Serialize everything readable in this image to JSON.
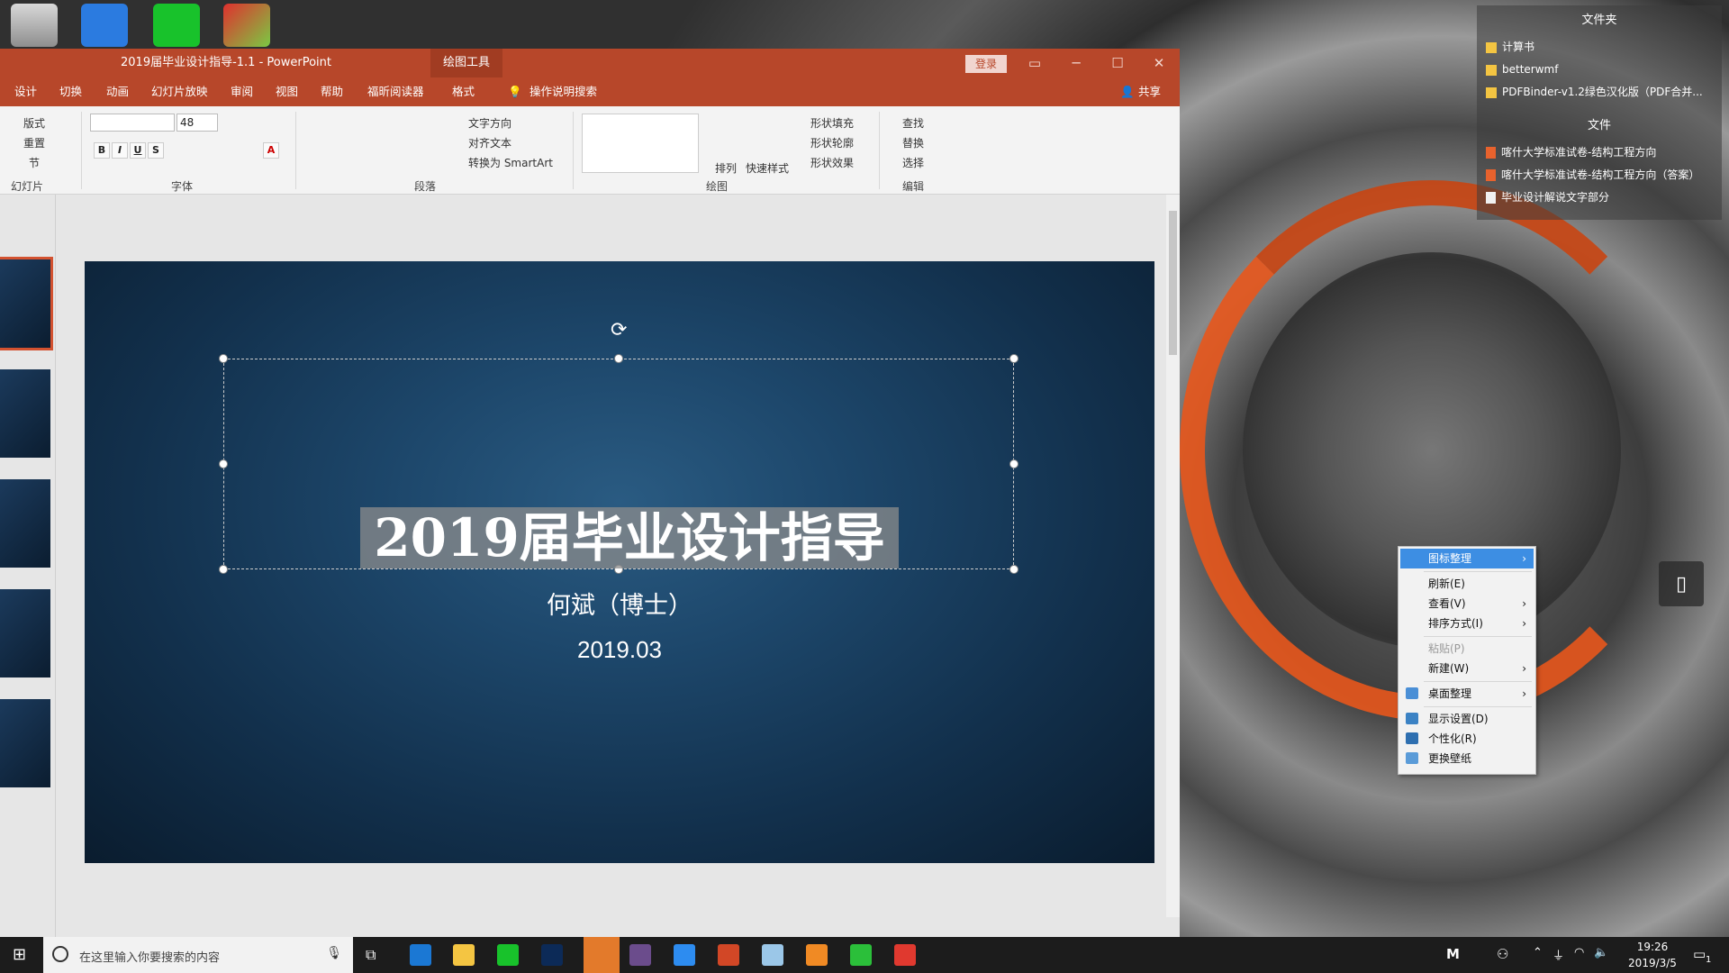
{
  "desktop": {
    "fences": {
      "folder_title": "文件夹",
      "folders": [
        "计算书",
        "betterwmf",
        "PDFBinder-v1.2绿色汉化版（PDF合并..."
      ],
      "file_title": "文件",
      "files": [
        "喀什大学标准试卷-结构工程方向",
        "喀什大学标准试卷-结构工程方向（答案）",
        "毕业设计解说文字部分"
      ]
    },
    "context_menu": {
      "items": [
        {
          "label": "图标整理",
          "submenu": true,
          "highlighted": true
        },
        {
          "label": "刷新(E)"
        },
        {
          "label": "查看(V)",
          "submenu": true
        },
        {
          "label": "排序方式(I)",
          "submenu": true
        },
        {
          "label": "粘贴(P)",
          "disabled": true
        },
        {
          "label": "新建(W)",
          "submenu": true
        },
        {
          "label": "桌面整理",
          "submenu": true
        },
        {
          "label": "显示设置(D)"
        },
        {
          "label": "个性化(R)"
        },
        {
          "label": "更换壁纸"
        }
      ]
    }
  },
  "ppt": {
    "title": "2019届毕业设计指导-1.1  -  PowerPoint",
    "tool_tab": "绘图工具",
    "login": "登录",
    "tabs": [
      "设计",
      "切换",
      "动画",
      "幻灯片放映",
      "审阅",
      "视图",
      "帮助",
      "福昕阅读器",
      "格式"
    ],
    "tell_me": "操作说明搜索",
    "share": "共享",
    "ribbon": {
      "slides_group": {
        "layout": "版式",
        "reset": "重置",
        "section": "节",
        "label": "幻灯片"
      },
      "font_group": {
        "size": "48",
        "label": "字体"
      },
      "para_group": {
        "text_dir": "文字方向",
        "align_text": "对齐文本",
        "smartart": "转换为 SmartArt",
        "label": "段落"
      },
      "draw_group": {
        "arrange": "排列",
        "quick_styles": "快速样式",
        "fill": "形状填充",
        "outline": "形状轮廓",
        "effects": "形状效果",
        "label": "绘图"
      },
      "edit_group": {
        "find": "查找",
        "replace": "替换",
        "select": "选择",
        "label": "编辑"
      }
    },
    "slide": {
      "title": "2019届毕业设计指导",
      "author": "何斌（博士）",
      "date": "2019.03"
    }
  },
  "taskbar": {
    "search_placeholder": "在这里输入你要搜索的内容",
    "ime": "M",
    "time": "19:26",
    "date": "2019/3/5",
    "notification_count": "1"
  },
  "colors": {
    "ppt_accent": "#b7472a",
    "menu_highlight": "#3d8ee3",
    "taskbar": "#1c1c1c"
  }
}
